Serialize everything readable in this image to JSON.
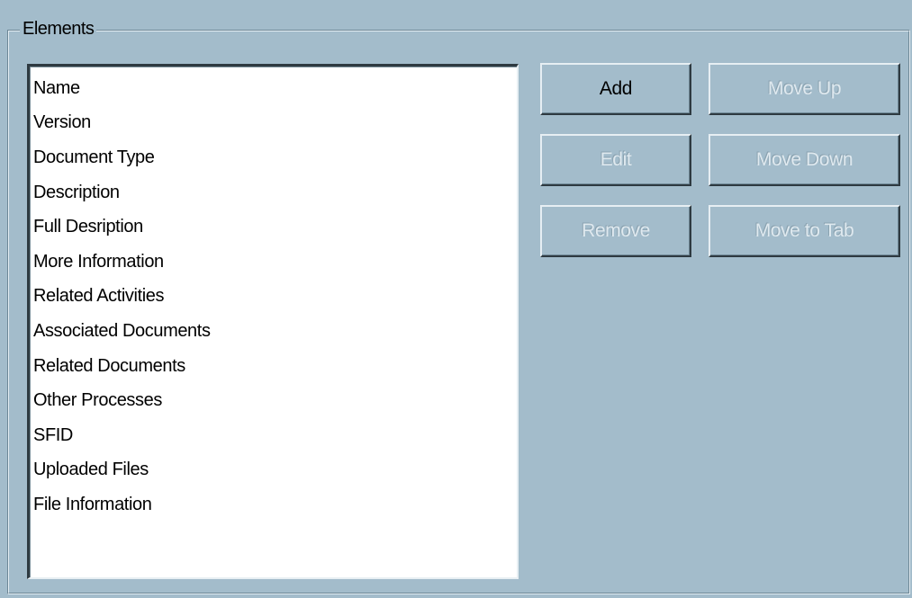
{
  "groupbox": {
    "title": "Elements"
  },
  "list": {
    "items": [
      "Name",
      "Version",
      "Document Type",
      "Description",
      "Full Desription",
      "More Information",
      "Related Activities",
      "Associated Documents",
      "Related Documents",
      "Other Processes",
      "SFID",
      "Uploaded Files",
      "File Information"
    ]
  },
  "buttons": {
    "add": "Add",
    "edit": "Edit",
    "remove": "Remove",
    "move_up": "Move Up",
    "move_down": "Move Down",
    "move_to_tab": "Move to Tab"
  },
  "colors": {
    "panel_bg": "#a3bccb",
    "list_bg": "#ffffff",
    "disabled_text": "#dfe9ef"
  }
}
